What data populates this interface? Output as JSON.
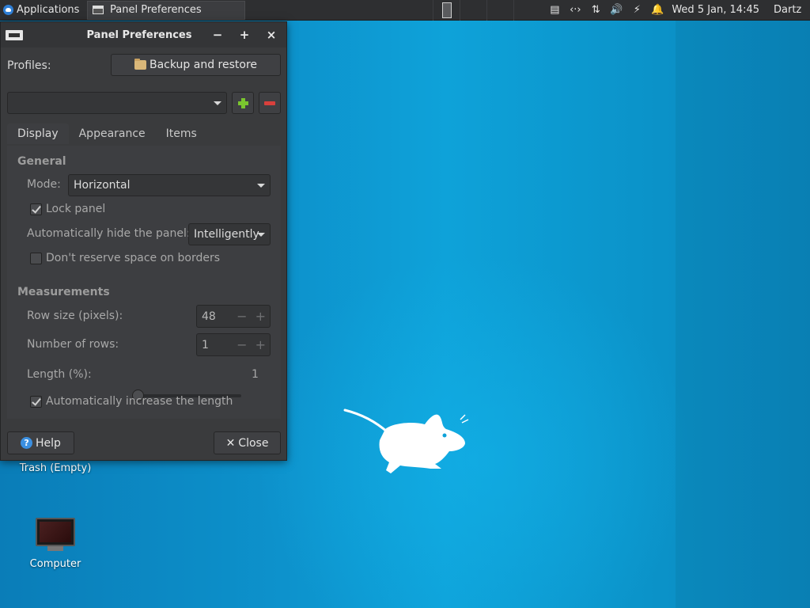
{
  "top_panel": {
    "applications_label": "Applications",
    "task_title": "Panel Preferences",
    "clock": "Wed  5 Jan, 14:45",
    "user": "Dartz"
  },
  "dialog": {
    "title": "Panel Preferences",
    "buttons": {
      "minimize": "−",
      "maximize": "+",
      "close": "×"
    },
    "profiles_label": "Profiles:",
    "backup_button": "Backup and restore",
    "profile_combo_value": "",
    "tabs": [
      {
        "label": "Display",
        "active": true
      },
      {
        "label": "Appearance",
        "active": false
      },
      {
        "label": "Items",
        "active": false
      }
    ],
    "general": {
      "title": "General",
      "mode_label": "Mode:",
      "mode_value": "Horizontal",
      "lock_panel_label": "Lock panel",
      "lock_panel_checked": true,
      "autohide_label": "Automatically hide the panel:",
      "autohide_value": "Intelligently",
      "reserve_label": "Don't reserve space on borders",
      "reserve_checked": false
    },
    "measurements": {
      "title": "Measurements",
      "row_size_label": "Row size (pixels):",
      "row_size_value": "48",
      "rows_label": "Number of rows:",
      "rows_value": "1",
      "length_label": "Length (%):",
      "length_value": "1",
      "auto_length_label": "Automatically increase the length",
      "auto_length_checked": true
    },
    "help_button": "Help",
    "close_button": "Close"
  },
  "desktop": {
    "icons": [
      {
        "label": "Trash (Empty)"
      },
      {
        "label": "Computer"
      }
    ]
  },
  "colors": {
    "desktop_blue": "#0ea2d9",
    "panel_bg": "#2e2f31",
    "dialog_bg": "#3a3b3d",
    "add_green": "#7ac52f",
    "remove_red": "#d8403c"
  }
}
